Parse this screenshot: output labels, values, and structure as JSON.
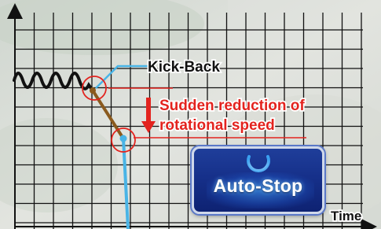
{
  "labels": {
    "kick_back": "Kick-Back",
    "reduction_line1": "Sudden reduction of",
    "reduction_line2": "rotational speed",
    "x_axis": "Time"
  },
  "button": {
    "label": "Auto-Stop",
    "icon": "power-icon"
  },
  "colors": {
    "grid": "#111111",
    "wave": "#111111",
    "brown_segment": "#8a5a1e",
    "blue_line": "#49b4e6",
    "highlight_red": "#e3231e",
    "button_blue": "#16308a"
  }
}
